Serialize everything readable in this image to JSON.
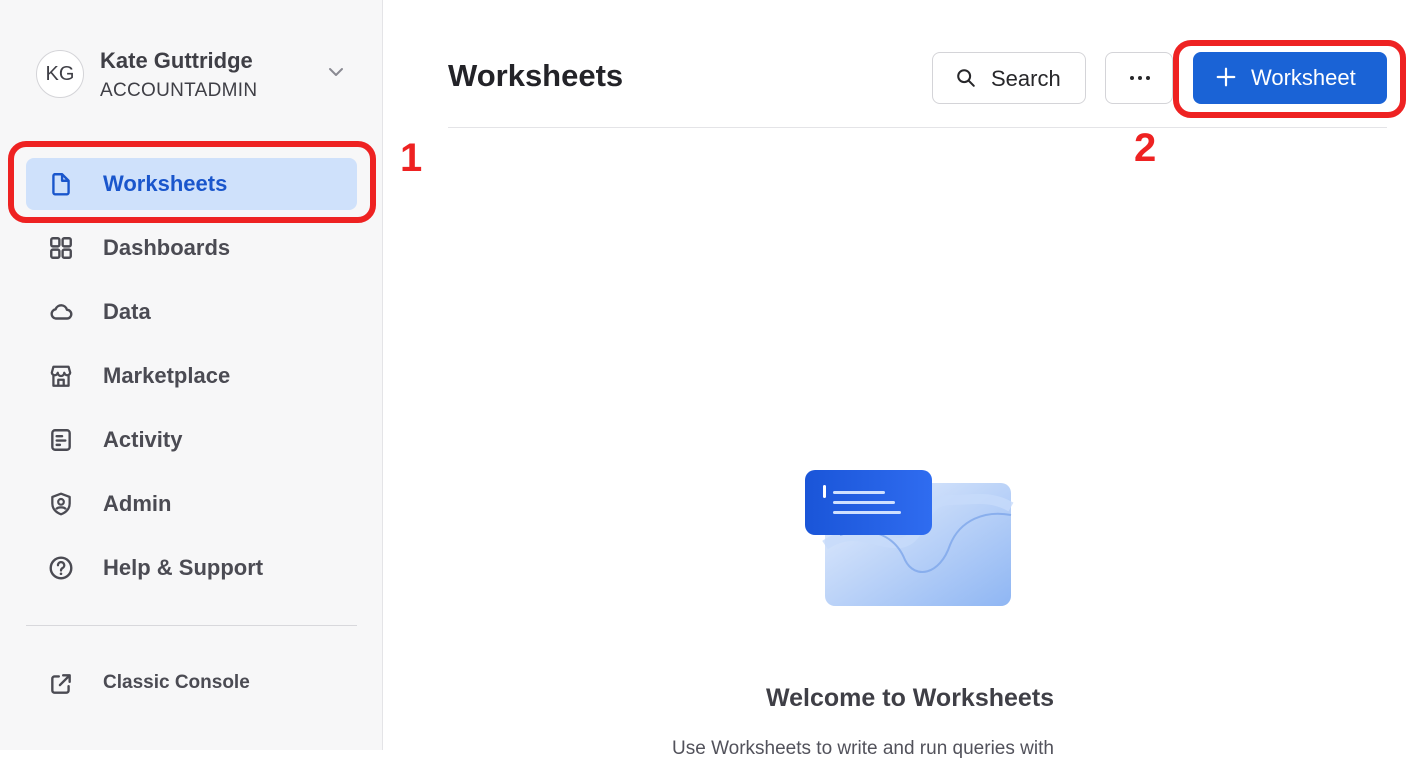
{
  "user": {
    "initials": "KG",
    "name": "Kate Guttridge",
    "role": "ACCOUNTADMIN"
  },
  "sidebar": {
    "items": [
      {
        "label": "Worksheets",
        "icon": "document-icon",
        "active": true
      },
      {
        "label": "Dashboards",
        "icon": "grid-icon",
        "active": false
      },
      {
        "label": "Data",
        "icon": "cloud-icon",
        "active": false
      },
      {
        "label": "Marketplace",
        "icon": "storefront-icon",
        "active": false
      },
      {
        "label": "Activity",
        "icon": "activity-log-icon",
        "active": false
      },
      {
        "label": "Admin",
        "icon": "shield-user-icon",
        "active": false
      },
      {
        "label": "Help & Support",
        "icon": "help-circle-icon",
        "active": false
      }
    ],
    "classic_console": "Classic Console"
  },
  "header": {
    "title": "Worksheets",
    "search_label": "Search",
    "more_icon": "more-horizontal-icon",
    "new_worksheet_label": "Worksheet"
  },
  "empty_state": {
    "title": "Welcome to Worksheets",
    "subtitle": "Use Worksheets to write and run queries with"
  },
  "annotations": {
    "one": "1",
    "two": "2"
  },
  "colors": {
    "accent": "#1a63d6",
    "active_bg": "#cfe1fb",
    "annotation": "#ee2222"
  }
}
